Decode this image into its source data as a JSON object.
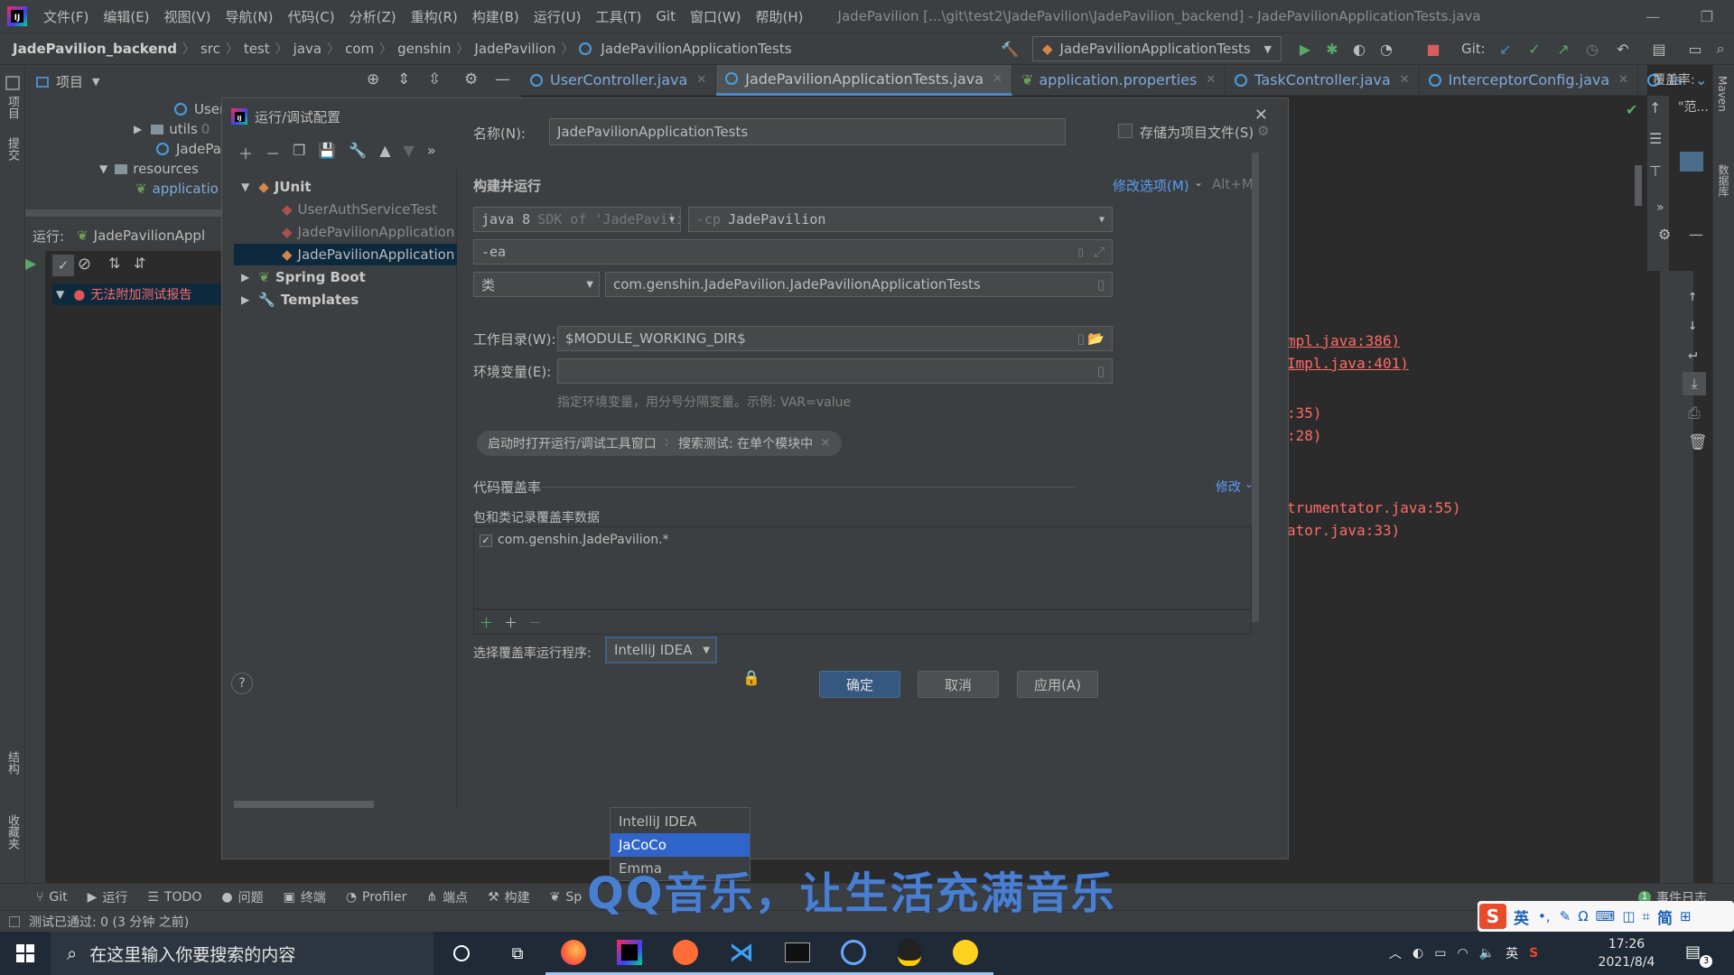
{
  "menubar": {
    "items": [
      "文件(F)",
      "编辑(E)",
      "视图(V)",
      "导航(N)",
      "代码(C)",
      "分析(Z)",
      "重构(R)",
      "构建(B)",
      "运行(U)",
      "工具(T)",
      "Git",
      "窗口(W)",
      "帮助(H)"
    ],
    "window_title": "JadePavilion [...\\git\\test2\\JadePavilion\\JadePavilion_backend] - JadePavilionApplicationTests.java"
  },
  "navbar": {
    "breadcrumbs": [
      "JadePavilion_backend",
      "src",
      "test",
      "java",
      "com",
      "genshin",
      "JadePavilion",
      "JadePavilionApplicationTests"
    ],
    "run_config": "JadePavilionApplicationTests",
    "git_label": "Git:"
  },
  "project_panel": {
    "title": "项目",
    "items": [
      "User",
      "utils",
      "JadePa",
      "resources",
      "applicatio"
    ],
    "utils_suffix": "0"
  },
  "run_panel": {
    "label": "运行:",
    "config": "JadePavilionAppl",
    "error_text": "无法附加测试报告"
  },
  "editor_tabs": [
    {
      "label": "UserController.java"
    },
    {
      "label": "JadePavilionApplicationTests.java"
    },
    {
      "label": "application.properties"
    },
    {
      "label": "TaskController.java"
    },
    {
      "label": "InterceptorConfig.java"
    },
    {
      "label": "Ta"
    }
  ],
  "coverage_label": "覆盖率:",
  "coverage_item": "\"范...",
  "console": {
    "lines": [
      "mpl.java:386)",
      "Impl.java:401)",
      ":35)",
      ":28)",
      "trumentator.java:55)",
      "ator.java:33)"
    ]
  },
  "right_tool": {
    "maven": "Maven",
    "database": "数据库"
  },
  "left_tool": {
    "project": "项目",
    "commit": "提交",
    "structure": "结构",
    "favorites": "收藏夹"
  },
  "dialog": {
    "title": "运行/调试配置",
    "tree": {
      "junit": "JUnit",
      "children": [
        "UserAuthServiceTest",
        "JadePavilionApplication",
        "JadePavilionApplication"
      ],
      "spring_boot": "Spring Boot",
      "templates": "Templates"
    },
    "name_label": "名称(N):",
    "name_value": "JadePavilionApplicationTests",
    "store_as_file": "存储为项目文件(S)",
    "build_run": "构建并运行",
    "modify_options": "修改选项(M)",
    "modify_shortcut": "Alt+M",
    "jdk": "java 8",
    "jdk_hint": "SDK of 'JadePavilion",
    "cp_prefix": "-cp",
    "cp_value": "JadePavilion",
    "vm_options": "-ea",
    "kind": "类",
    "class_value": "com.genshin.JadePavilion.JadePavilionApplicationTests",
    "workdir_label": "工作目录(W):",
    "workdir_value": "$MODULE_WORKING_DIR$",
    "env_label": "环境变量(E):",
    "env_hint": "指定环境变量，用分号分隔变量。示例: VAR=value",
    "chip1": "启动时打开运行/调试工具窗口",
    "chip2": "搜索测试: 在单个模块中",
    "coverage_section": "代码覆盖率",
    "modify": "修改",
    "record_label": "包和类记录覆盖率数据",
    "pattern": "com.genshin.JadePavilion.*",
    "runner_label": "选择覆盖率运行程序:",
    "runner_value": "IntelliJ IDEA",
    "runner_options": [
      "IntelliJ IDEA",
      "JaCoCo",
      "Emma"
    ],
    "ok": "确定",
    "cancel": "取消",
    "apply": "应用(A)",
    "help": "?"
  },
  "bottom_tools": [
    "Git",
    "运行",
    "TODO",
    "问题",
    "终端",
    "Profiler",
    "端点",
    "构建",
    "Sp"
  ],
  "event_log": "事件日志",
  "event_count": "1",
  "status_text": "测试已通过: 0 (3 分钟 之前)",
  "overlay_text": "QQ音乐，让生活充满音乐",
  "ime": {
    "lang": "英",
    "simp": "简"
  },
  "taskbar": {
    "search_placeholder": "在这里输入你要搜索的内容",
    "time": "17:26",
    "date": "2021/8/4",
    "notif_count": "3",
    "tray_lang": "英"
  }
}
